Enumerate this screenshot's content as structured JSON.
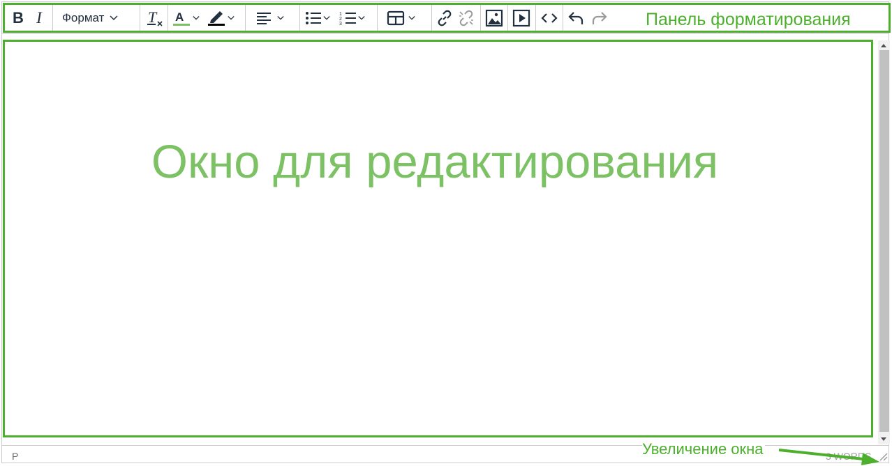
{
  "toolbar": {
    "format_label": "Формат",
    "annotation": "Панель форматирования",
    "text_color": "#7cc164",
    "highlight_color": "#000000"
  },
  "content": {
    "caption": "Окно для редактирования"
  },
  "statusbar": {
    "path": "P",
    "word_count": "3 WORDS",
    "resize_annotation": "Увеличение окна"
  },
  "colors": {
    "annotation_green": "#4cb02d",
    "caption_green": "#7cc164",
    "toolbar_icon": "#222f3e",
    "disabled_icon": "#9a9a9a"
  }
}
